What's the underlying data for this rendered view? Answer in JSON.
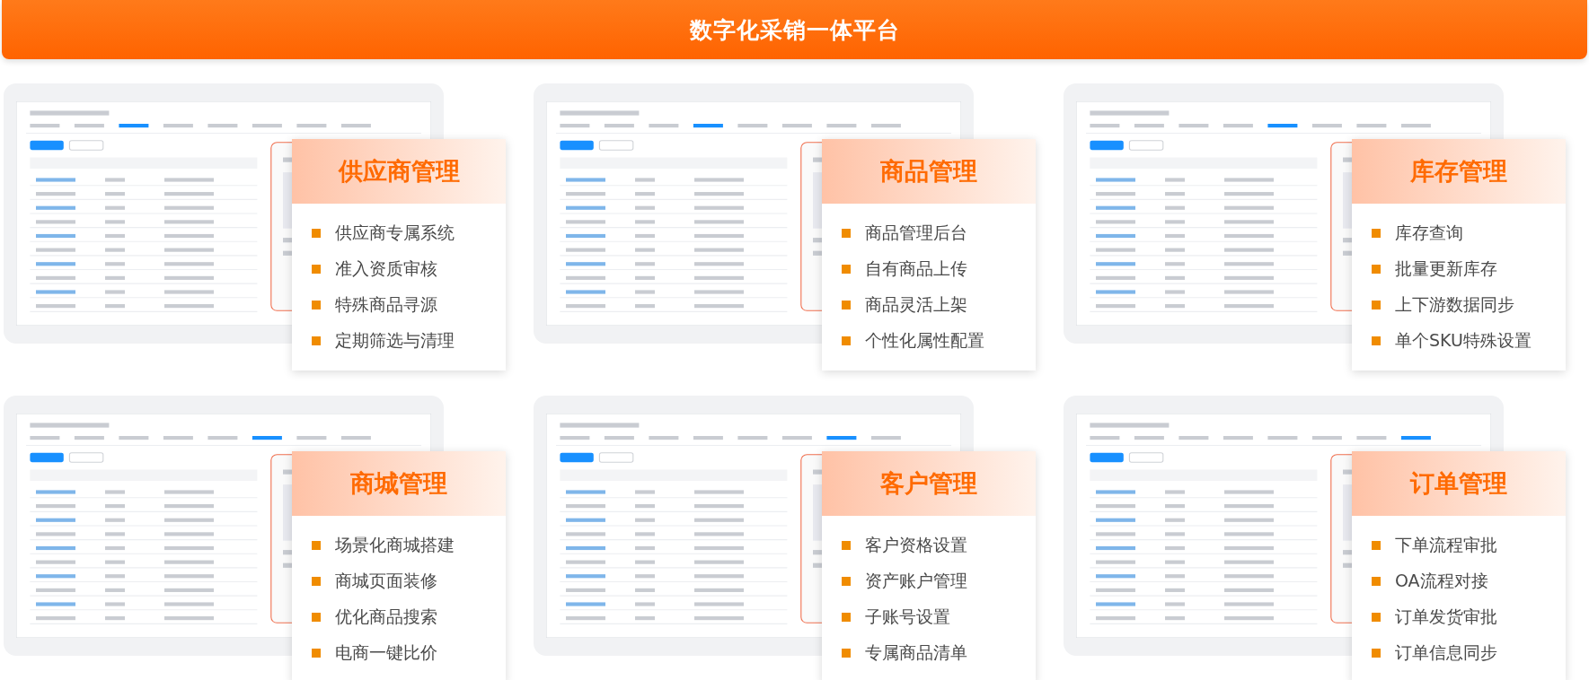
{
  "header": {
    "title": "数字化采销一体平台"
  },
  "modules": [
    {
      "title": "供应商管理",
      "features": [
        "供应商专属系统",
        "准入资质审核",
        "特殊商品寻源",
        "定期筛选与清理"
      ]
    },
    {
      "title": "商品管理",
      "features": [
        "商品管理后台",
        "自有商品上传",
        "商品灵活上架",
        "个性化属性配置"
      ]
    },
    {
      "title": "库存管理",
      "features": [
        "库存查询",
        "批量更新库存",
        "上下游数据同步",
        "单个SKU特殊设置"
      ]
    },
    {
      "title": "商城管理",
      "features": [
        "场景化商城搭建",
        "商城页面装修",
        "优化商品搜索",
        "电商一键比价"
      ]
    },
    {
      "title": "客户管理",
      "features": [
        "客户资格设置",
        "资产账户管理",
        "子账号设置",
        "专属商品清单"
      ]
    },
    {
      "title": "订单管理",
      "features": [
        "下单流程审批",
        "OA流程对接",
        "订单发货审批",
        "订单信息同步"
      ]
    }
  ]
}
